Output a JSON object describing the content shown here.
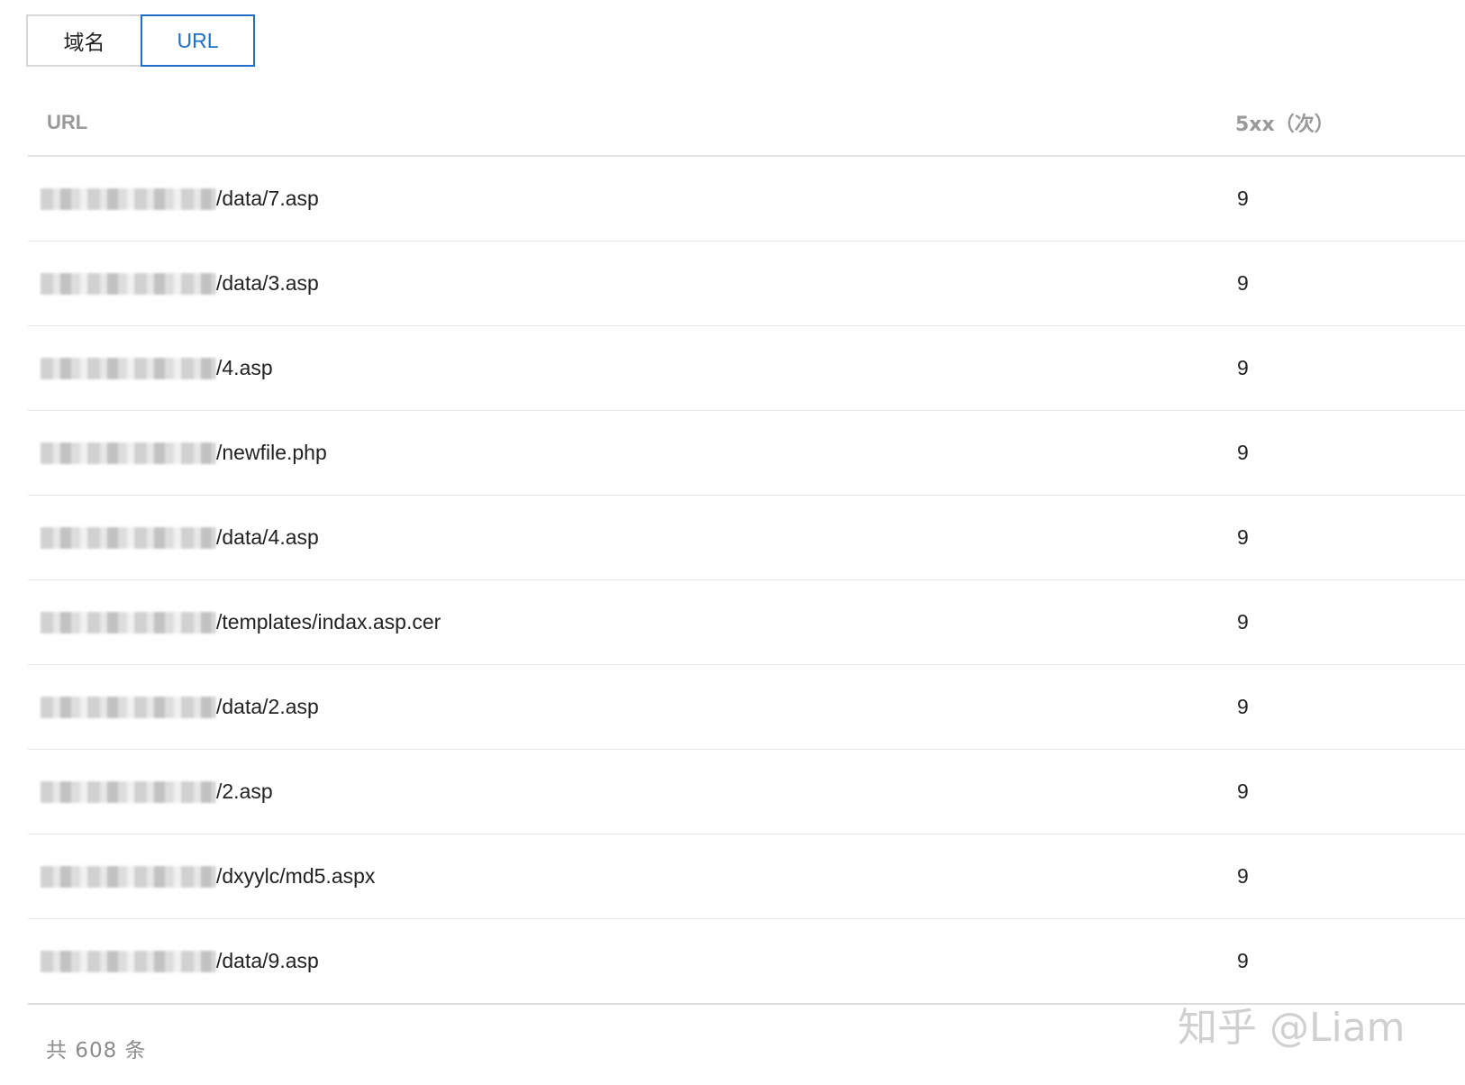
{
  "tabs": [
    {
      "label": "域名",
      "active": false
    },
    {
      "label": "URL",
      "active": true
    }
  ],
  "table": {
    "headers": {
      "url": "URL",
      "count": "5xx（次）"
    },
    "rows": [
      {
        "path": "/data/7.asp",
        "count": "9"
      },
      {
        "path": "/data/3.asp",
        "count": "9"
      },
      {
        "path": "/4.asp",
        "count": "9"
      },
      {
        "path": "/newfile.php",
        "count": "9"
      },
      {
        "path": "/data/4.asp",
        "count": "9"
      },
      {
        "path": "/templates/indax.asp.cer",
        "count": "9"
      },
      {
        "path": "/data/2.asp",
        "count": "9"
      },
      {
        "path": "/2.asp",
        "count": "9"
      },
      {
        "path": "/dxyylc/md5.aspx",
        "count": "9"
      },
      {
        "path": "/data/9.asp",
        "count": "9"
      }
    ]
  },
  "footer": {
    "total_text": "共 608 条"
  },
  "watermark": {
    "text": "知乎 @Liam"
  },
  "colors": {
    "accent": "#1e6fc8",
    "header_text": "#999999",
    "border": "#e6e6e6"
  }
}
